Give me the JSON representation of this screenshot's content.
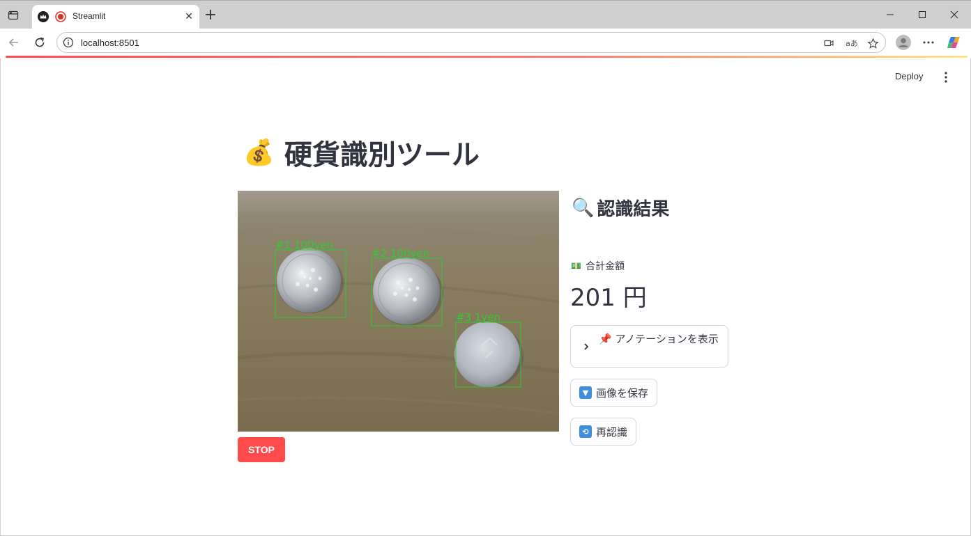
{
  "browser": {
    "tab_title": "Streamlit",
    "url": "localhost:8501",
    "translate_label": "aあ"
  },
  "header": {
    "deploy_label": "Deploy"
  },
  "main": {
    "title_emoji": "💰",
    "title": "硬貨識別ツール",
    "stop_label": "STOP",
    "detections": [
      {
        "label": "#1 100yen"
      },
      {
        "label": "#2 100yen"
      },
      {
        "label": "#3 1yen"
      }
    ]
  },
  "results": {
    "header_emoji": "🔍",
    "header": "認識結果",
    "metric_emoji": "💵",
    "metric_label": "合計金額",
    "metric_value": "201 円",
    "expander_emoji": "📌",
    "expander_label": "アノテーションを表示",
    "save_label": "画像を保存",
    "rerecognize_label": "再認識"
  },
  "colors": {
    "accent": "#ff4b4b",
    "text": "#31333f",
    "detection_box": "#2ecc2e"
  }
}
